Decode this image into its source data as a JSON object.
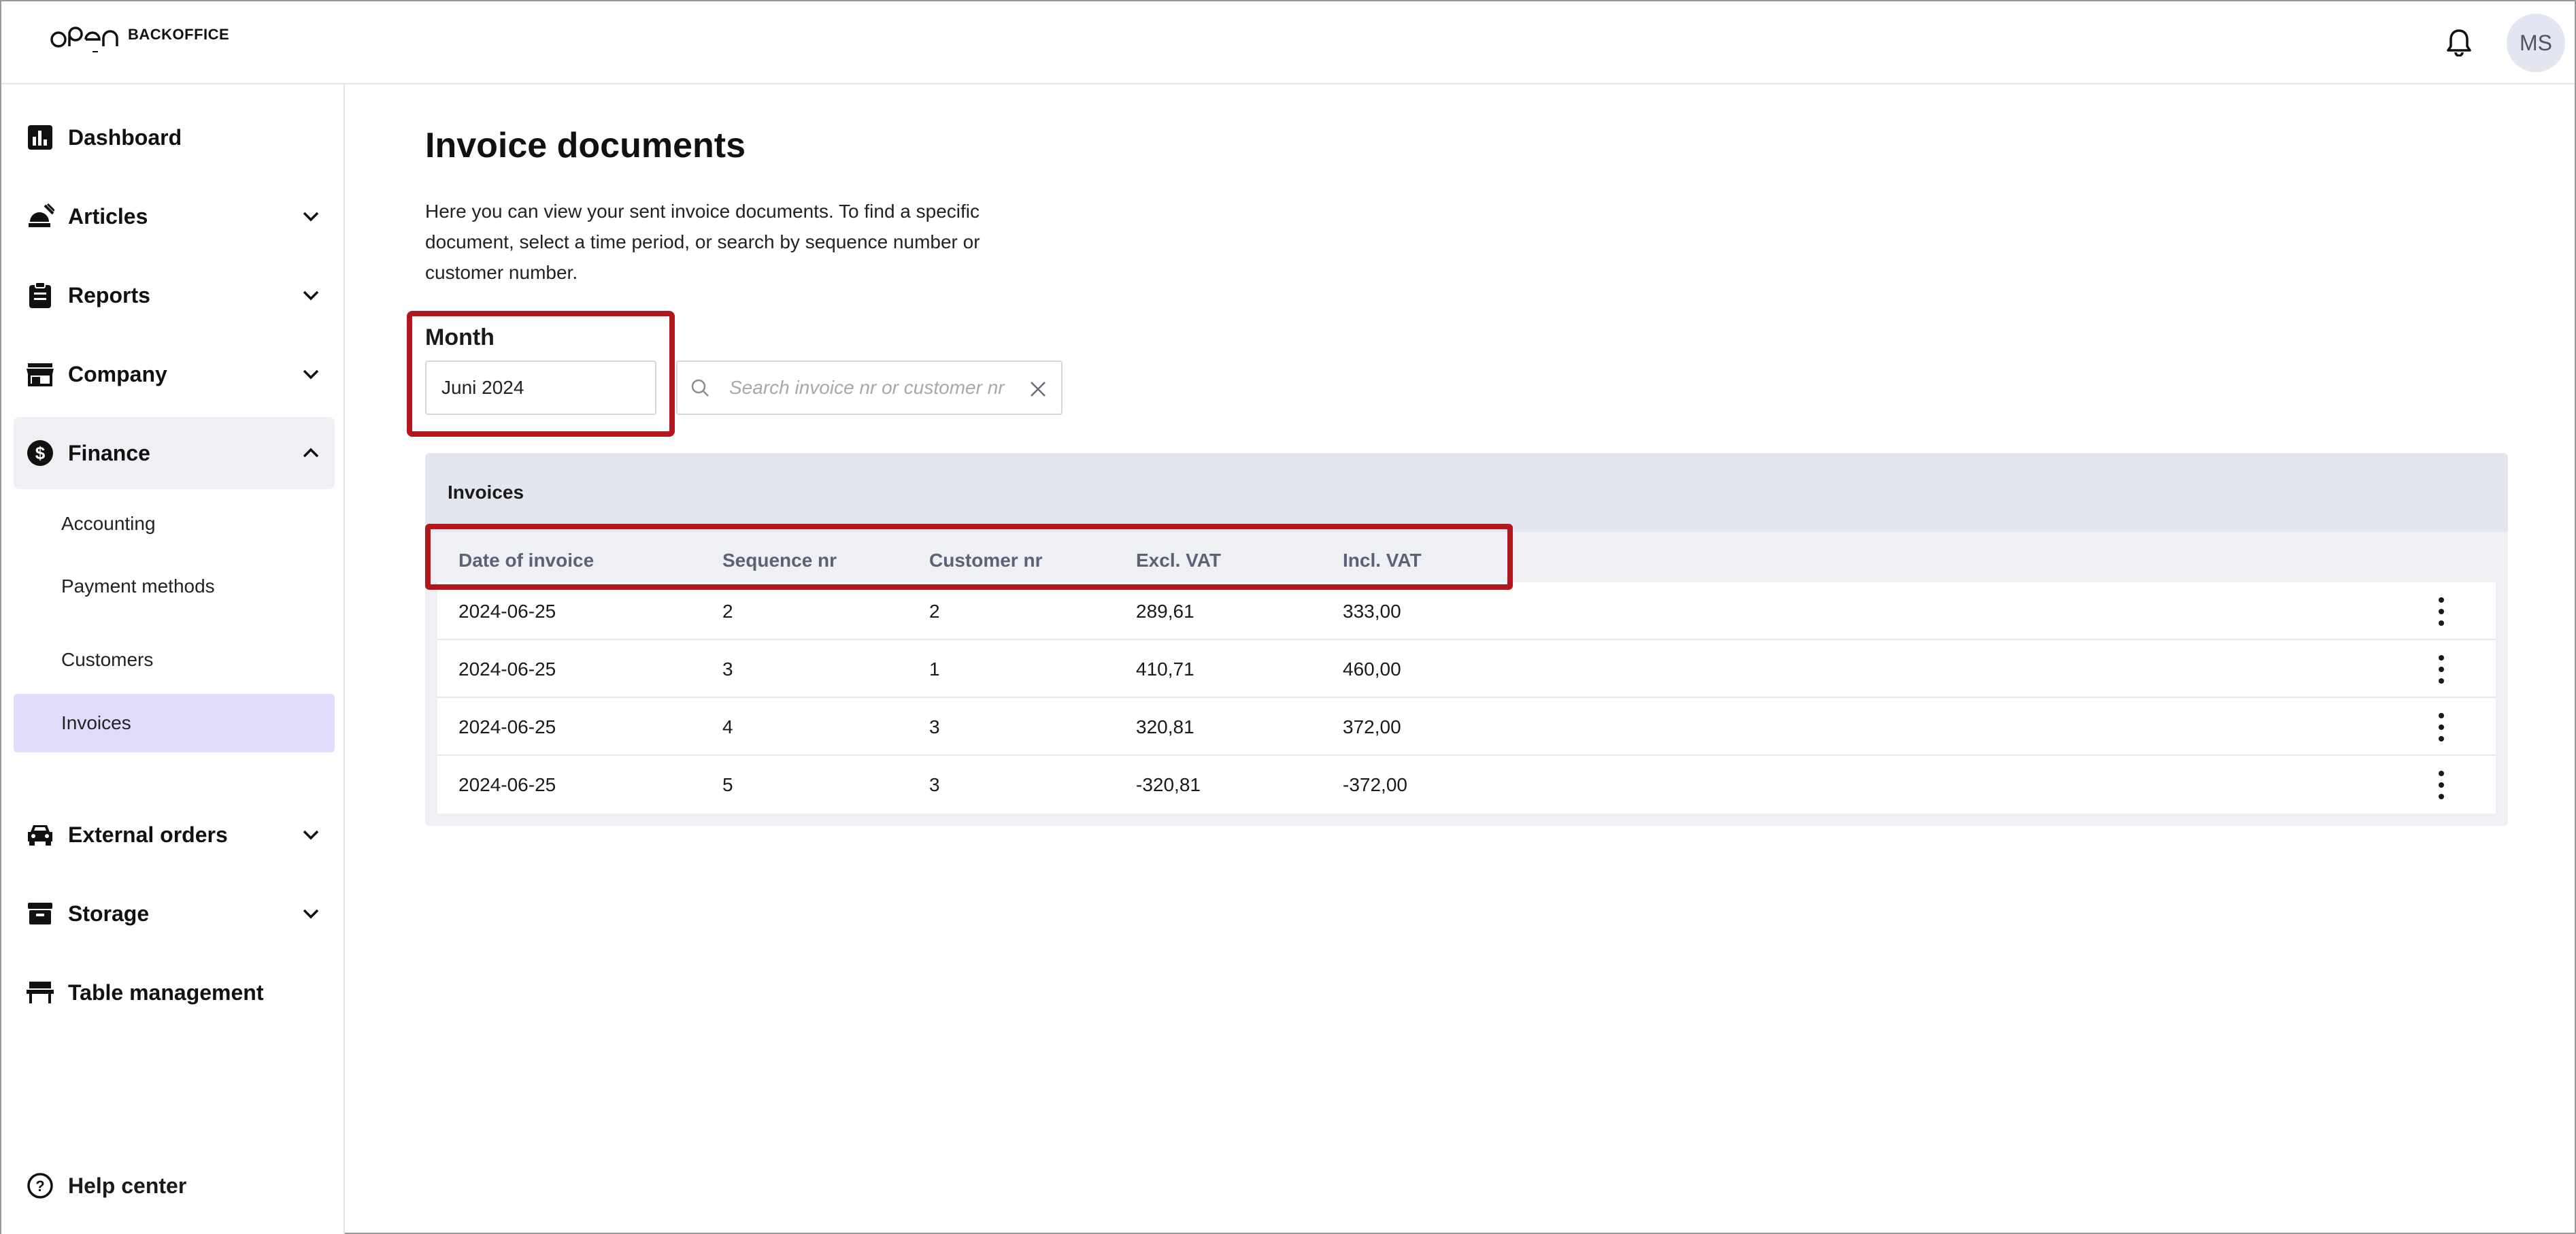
{
  "header": {
    "logo_sub": "BACKOFFICE",
    "avatar_initials": "MS"
  },
  "sidebar": {
    "items": [
      {
        "label": "Dashboard",
        "icon": "bar-chart-icon"
      },
      {
        "label": "Articles",
        "icon": "food-icon"
      },
      {
        "label": "Reports",
        "icon": "clipboard-icon"
      },
      {
        "label": "Company",
        "icon": "store-icon"
      },
      {
        "label": "Finance",
        "icon": "dollar-icon"
      },
      {
        "label": "External orders",
        "icon": "car-icon"
      },
      {
        "label": "Storage",
        "icon": "archive-icon"
      },
      {
        "label": "Table management",
        "icon": "table-icon"
      }
    ],
    "finance_sub": [
      "Accounting",
      "Payment methods",
      "Customers",
      "Invoices"
    ],
    "help": "Help center"
  },
  "main": {
    "title": "Invoice documents",
    "description": "Here you can view your sent invoice documents. To find a specific document, select a time period, or search by sequence number or customer number.",
    "month_label": "Month",
    "month_value": "Juni 2024",
    "search_placeholder": "Search invoice nr or customer nr"
  },
  "table": {
    "title": "Invoices",
    "columns": [
      "Date of invoice",
      "Sequence nr",
      "Customer nr",
      "Excl. VAT",
      "Incl. VAT"
    ],
    "rows": [
      [
        "2024-06-25",
        "2",
        "2",
        "289,61",
        "333,00"
      ],
      [
        "2024-06-25",
        "3",
        "1",
        "410,71",
        "460,00"
      ],
      [
        "2024-06-25",
        "4",
        "3",
        "320,81",
        "372,00"
      ],
      [
        "2024-06-25",
        "5",
        "3",
        "-320,81",
        "-372,00"
      ]
    ]
  },
  "colors": {
    "highlight": "#b3161c",
    "active_sub": "#e1dcfb",
    "panel_header": "#e4e6ef"
  }
}
